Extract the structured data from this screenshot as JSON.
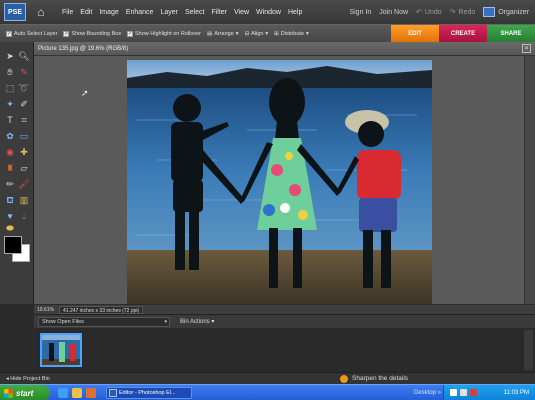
{
  "app": {
    "logo_text": "PSE",
    "menus": [
      "File",
      "Edit",
      "Image",
      "Enhance",
      "Layer",
      "Select",
      "Filter",
      "View",
      "Window",
      "Help"
    ],
    "sign_in": "Sign In",
    "join_now": "Join Now",
    "undo": "Undo",
    "redo": "Redo",
    "organizer": "Organizer"
  },
  "options": {
    "auto_select_layer": "Auto Select Layer",
    "show_bounding_box": "Show Bounding Box",
    "show_highlight": "Show Highlight on Rollover",
    "arrange": "Arrange",
    "align": "Align",
    "distribute": "Distribute"
  },
  "mode_tabs": {
    "edit": "EDIT",
    "create": "CREATE",
    "share": "SHARE"
  },
  "document": {
    "title": "Picture 135.jpg @ 19.6% (RGB/8)",
    "zoom": "19.61%",
    "info": "41.247 inches x 33 inches (72 ppi)"
  },
  "bin": {
    "show_select": "Show Open Files",
    "bin_actions": "Bin Actions",
    "hide_project_bin": "Hide Project Bin",
    "tip": "Sharpen the details"
  },
  "taskbar": {
    "start": "start",
    "task_item": "Editor - Photoshop El...",
    "desktop": "Desktop",
    "clock": "11:03 PM"
  },
  "colors": {
    "edit_tab": "#f08a10",
    "create_tab": "#c81d50",
    "share_tab": "#34a040",
    "foreground": "#000000",
    "background": "#ffffff"
  }
}
